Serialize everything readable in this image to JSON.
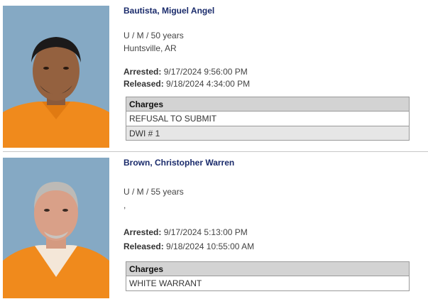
{
  "records": [
    {
      "name": "Bautista, Miguel Angel",
      "demographics": "U / M / 50 years",
      "location": "Huntsville, AR",
      "arrested_label": "Arrested:",
      "arrested": "9/17/2024 9:56:00 PM",
      "released_label": "Released:",
      "released": "9/18/2024 4:34:00 PM",
      "charges_header": "Charges",
      "charges": [
        "REFUSAL TO SUBMIT",
        "DWI # 1"
      ]
    },
    {
      "name": "Brown, Christopher Warren",
      "demographics": "U / M / 55 years",
      "location": ",",
      "arrested_label": "Arrested:",
      "arrested": "9/17/2024 5:13:00 PM",
      "released_label": "Released:",
      "released": "9/18/2024 10:55:00 AM",
      "charges_header": "Charges",
      "charges": [
        "WHITE WARRANT"
      ]
    }
  ],
  "colors": {
    "name_link": "#1a2b6b",
    "photo_background": "#85a9c4",
    "jumpsuit": "#f08a1c",
    "charges_header_bg": "#d3d3d3"
  }
}
